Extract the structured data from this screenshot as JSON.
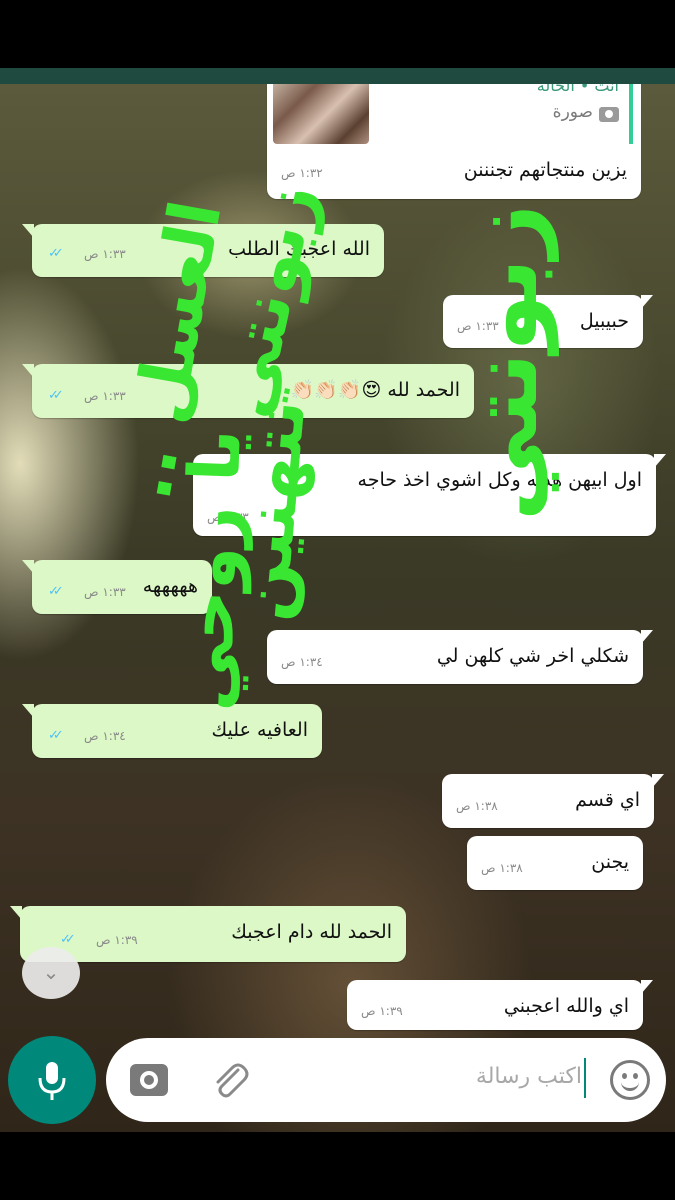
{
  "quoted": {
    "label": "أنت • الخالة",
    "sub": "صورة",
    "icon": "camera-icon"
  },
  "messages": [
    {
      "dir": "in",
      "text": "يزين منتجاتهم تجنننن",
      "time": "١:٣٢ ص"
    },
    {
      "dir": "out",
      "text": "الله اعجبك الطلب",
      "time": "١:٣٣ ص",
      "ticks": "✓✓"
    },
    {
      "dir": "in",
      "text": "حبيبيل",
      "time": "١:٣٣ ص"
    },
    {
      "dir": "out",
      "text": "الحمد لله 😍👏🏻👏🏻👏🏻",
      "time": "١:٣٣ ص",
      "ticks": "✓✓"
    },
    {
      "dir": "in",
      "text": "اول ابيهن هديه وكل اشوي اخذ حاجه",
      "time": "١:٣٣ ص"
    },
    {
      "dir": "out",
      "text": "هههههه",
      "time": "١:٣٣ ص",
      "ticks": "✓✓"
    },
    {
      "dir": "in",
      "text": "شكلي اخر شي كلهن لي",
      "time": "١:٣٤ ص"
    },
    {
      "dir": "out",
      "text": "العافيه عليك",
      "time": "١:٣٤ ص",
      "ticks": "✓✓"
    },
    {
      "dir": "in",
      "text": "اي قسم",
      "time": "١:٣٨ ص"
    },
    {
      "dir": "in",
      "text": "يجنن",
      "time": "١:٣٨ ص"
    },
    {
      "dir": "out",
      "text": "الحمد لله دام اعجبك",
      "time": "١:٣٩ ص",
      "ticks": "✓✓"
    },
    {
      "dir": "in",
      "text": "اي والله اعجبني",
      "time": "١:٣٩ ص"
    }
  ],
  "overlay": {
    "line1": "زبونتي",
    "line2": "العسل ..",
    "line3": "تتهنين",
    "line4": "يا روحي",
    "color": "#39e632"
  },
  "composer": {
    "placeholder": "اكتب رسالة",
    "emoji_icon": "emoji-icon",
    "attach_icon": "paperclip-icon",
    "camera_icon": "camera-icon",
    "mic_icon": "microphone-icon",
    "accent": "#00897b"
  },
  "scroll_down_icon": "double-chevron-down-icon"
}
